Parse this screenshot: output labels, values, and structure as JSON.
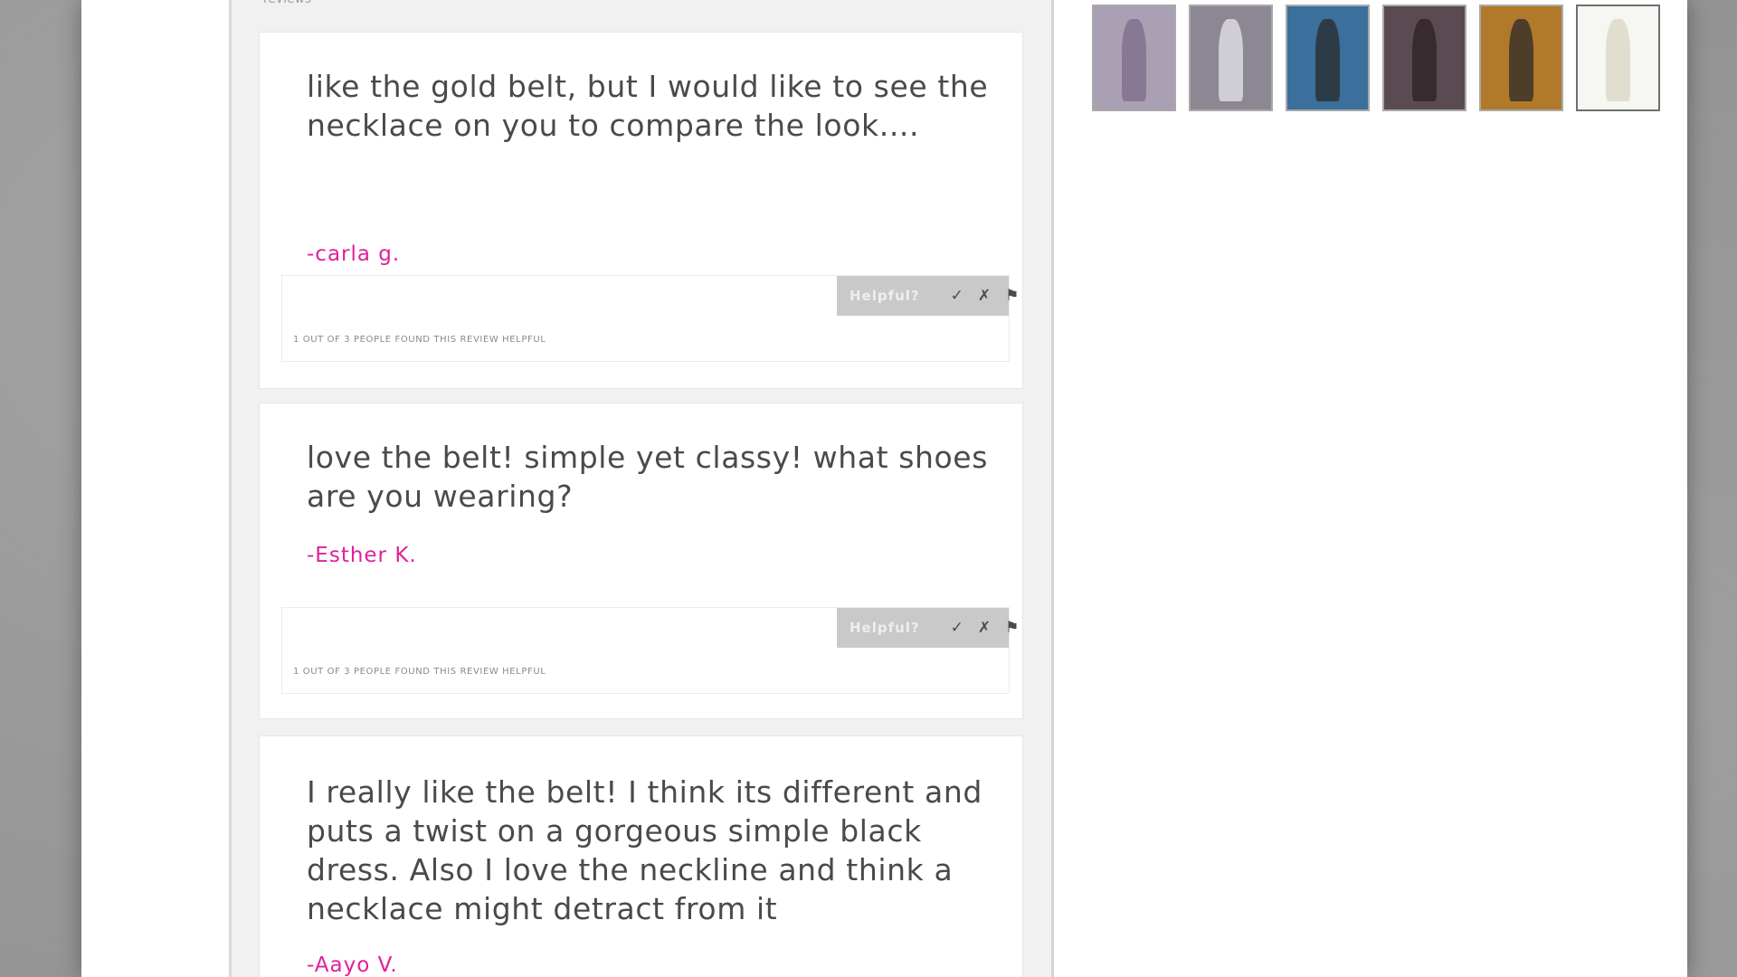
{
  "reviews_section": {
    "label": "reviews"
  },
  "reviews": [
    {
      "text": "like the gold belt, but I would like to see the necklace on you to compare the look....",
      "author": "-carla g.",
      "helpful_label": "Helpful?",
      "vote_icons": [
        "✓",
        "✗",
        "⚑"
      ],
      "helpful_stat": "1 out of 3 people found this review helpful"
    },
    {
      "text": "love the belt! simple yet classy! what shoes are you wearing?",
      "author": "-Esther K.",
      "helpful_label": "Helpful?",
      "vote_icons": [
        "✓",
        "✗",
        "⚑"
      ],
      "helpful_stat": "1 out of 3 people found this review helpful"
    },
    {
      "text": "I really like the belt! I think its different and puts a twist on a gorgeous simple black dress. Also I love the neckline and think a necklace might detract from it",
      "author": "-Aayo V."
    }
  ],
  "thumbnails": [
    {
      "name": "thumbnail-1",
      "bg": "#a9a0b3",
      "figure": "#7c6c8a",
      "selected": false
    },
    {
      "name": "thumbnail-2",
      "bg": "#8d8794",
      "figure": "#e6e6ea",
      "selected": false
    },
    {
      "name": "thumbnail-3",
      "bg": "#3b6f9c",
      "figure": "#2a2a2a",
      "selected": false
    },
    {
      "name": "thumbnail-4",
      "bg": "#5a4a52",
      "figure": "#2d2226",
      "selected": false
    },
    {
      "name": "thumbnail-5",
      "bg": "#b07a2a",
      "figure": "#2b2b2b",
      "selected": false
    },
    {
      "name": "thumbnail-6",
      "bg": "#f6f6f2",
      "figure": "#d9d6c4",
      "selected": true
    }
  ],
  "colors": {
    "author_accent": "#e0209a",
    "panel_bg": "#f1f1f1",
    "helpful_bar": "#c9c9c9"
  }
}
